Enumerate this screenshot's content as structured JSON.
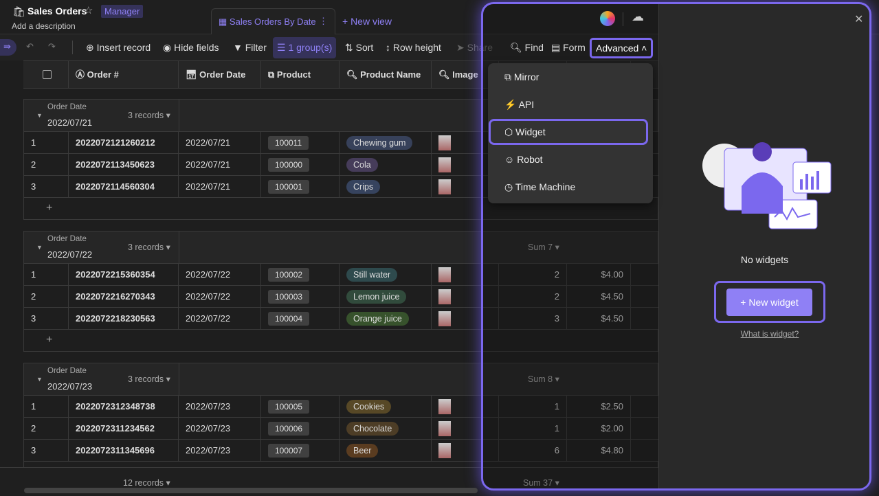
{
  "header": {
    "title": "Sales Orders",
    "role_badge": "Manager",
    "description": "Add a description",
    "view_tab": "Sales Orders By Date",
    "new_view": "+ New view"
  },
  "toolbar": {
    "insert": "Insert record",
    "hide": "Hide fields",
    "filter": "Filter",
    "group": "1 group(s)",
    "sort": "Sort",
    "row_height": "Row height",
    "share": "Share",
    "find": "Find",
    "form": "Form",
    "advanced": "Advanced"
  },
  "columns": [
    "Order #",
    "Order Date",
    "Product",
    "Product Name",
    "Image"
  ],
  "group_label": "Order Date",
  "groups": [
    {
      "date": "2022/07/21",
      "count": "3 records",
      "sum": "",
      "rows": [
        {
          "n": "1",
          "order": "2022072121260212",
          "date": "2022/07/21",
          "product": "100011",
          "name": "Chewing gum",
          "color": "#37415a",
          "qty": "",
          "price": ""
        },
        {
          "n": "2",
          "order": "2022072113450623",
          "date": "2022/07/21",
          "product": "100000",
          "name": "Cola",
          "color": "#463c5a",
          "qty": "",
          "price": ""
        },
        {
          "n": "3",
          "order": "2022072114560304",
          "date": "2022/07/21",
          "product": "100001",
          "name": "Crips",
          "color": "#36435e",
          "qty": "",
          "price": ""
        }
      ]
    },
    {
      "date": "2022/07/22",
      "count": "3 records",
      "sum": "Sum 7",
      "rows": [
        {
          "n": "1",
          "order": "2022072215360354",
          "date": "2022/07/22",
          "product": "100002",
          "name": "Still water",
          "color": "#2e4a4d",
          "qty": "2",
          "price": "$4.00"
        },
        {
          "n": "2",
          "order": "2022072216270343",
          "date": "2022/07/22",
          "product": "100003",
          "name": "Lemon juice",
          "color": "#314b3c",
          "qty": "2",
          "price": "$4.50"
        },
        {
          "n": "3",
          "order": "2022072218230563",
          "date": "2022/07/22",
          "product": "100004",
          "name": "Orange juice",
          "color": "#37522c",
          "qty": "3",
          "price": "$4.50"
        }
      ]
    },
    {
      "date": "2022/07/23",
      "count": "3 records",
      "sum": "Sum 8",
      "rows": [
        {
          "n": "1",
          "order": "2022072312348738",
          "date": "2022/07/23",
          "product": "100005",
          "name": "Cookies",
          "color": "#574826",
          "qty": "1",
          "price": "$2.50"
        },
        {
          "n": "2",
          "order": "2022072311234562",
          "date": "2022/07/23",
          "product": "100006",
          "name": "Chocolate",
          "color": "#4d3d26",
          "qty": "1",
          "price": "$2.00"
        },
        {
          "n": "3",
          "order": "2022072311345696",
          "date": "2022/07/23",
          "product": "100007",
          "name": "Beer",
          "color": "#5a3c20",
          "qty": "6",
          "price": "$4.80"
        }
      ]
    }
  ],
  "footer": {
    "count": "12 records",
    "sum": "Sum 37"
  },
  "menu": [
    "Mirror",
    "API",
    "Widget",
    "Robot",
    "Time Machine"
  ],
  "widget_panel": {
    "empty": "No widgets",
    "new_button": "+ New widget",
    "help": "What is widget?"
  },
  "accent": "#7b68ee"
}
